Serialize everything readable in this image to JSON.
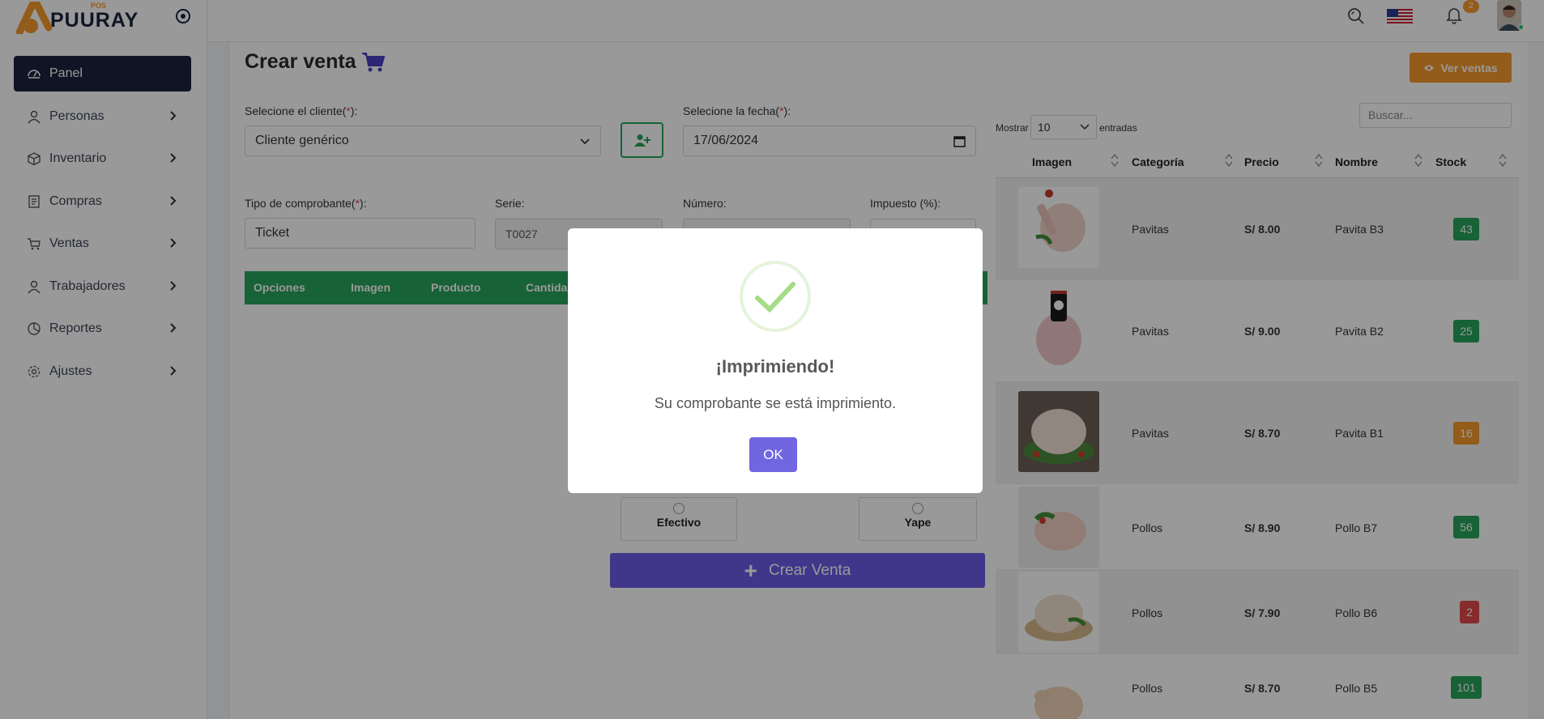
{
  "brand": {
    "name": "PUURAY",
    "tag": "POS",
    "accent": "#f59a2c",
    "dark": "#1c2340"
  },
  "sidebar": {
    "items": [
      {
        "label": "Panel",
        "icon": "gauge-icon",
        "active": true
      },
      {
        "label": "Personas",
        "icon": "user-icon"
      },
      {
        "label": "Inventario",
        "icon": "box-icon"
      },
      {
        "label": "Compras",
        "icon": "receipt-icon"
      },
      {
        "label": "Ventas",
        "icon": "cart-icon"
      },
      {
        "label": "Trabajadores",
        "icon": "user-icon"
      },
      {
        "label": "Reportes",
        "icon": "pie-chart-icon"
      },
      {
        "label": "Ajustes",
        "icon": "gear-icon"
      }
    ]
  },
  "topbar": {
    "notifications": "2",
    "language_icon": "us-flag-icon"
  },
  "page": {
    "title": "Crear venta",
    "view_sales": "Ver ventas"
  },
  "form": {
    "client_label": "Selecione el cliente(",
    "client_req": "*",
    "client_label_end": "):",
    "client_value": "Cliente genérico",
    "date_label": "Selecione la fecha(",
    "date_req": "*",
    "date_label_end": "):",
    "date_value": "17/06/2024",
    "voucher_label": "Tipo de comprobante(",
    "voucher_req": "*",
    "voucher_label_end": "):",
    "voucher_value": "Ticket",
    "series_label": "Serie:",
    "series_value": "T0027",
    "number_label": "Número:",
    "tax_label": "Impuesto (%):"
  },
  "detail_table": {
    "columns": [
      "Opciones",
      "Imagen",
      "Producto",
      "Cantida"
    ]
  },
  "payment": {
    "cash": "Efectivo",
    "yape": "Yape"
  },
  "create_button": "Crear Venta",
  "products": {
    "show_label": "Mostrar",
    "entries_label": "entradas",
    "page_length": "10",
    "search_placeholder": "Buscar...",
    "columns": [
      "Imagen",
      "Categoría",
      "Precio",
      "Nombre",
      "Stock"
    ],
    "rows": [
      {
        "category": "Pavitas",
        "price": "S/ 8.00",
        "name": "Pavita B3",
        "stock": "43",
        "stock_color": "#27a35a"
      },
      {
        "category": "Pavitas",
        "price": "S/ 9.00",
        "name": "Pavita B2",
        "stock": "25",
        "stock_color": "#27a35a"
      },
      {
        "category": "Pavitas",
        "price": "S/ 8.70",
        "name": "Pavita B1",
        "stock": "16",
        "stock_color": "#f59a2c"
      },
      {
        "category": "Pollos",
        "price": "S/ 8.90",
        "name": "Pollo B7",
        "stock": "56",
        "stock_color": "#27a35a"
      },
      {
        "category": "Pollos",
        "price": "S/ 7.90",
        "name": "Pollo B6",
        "stock": "2",
        "stock_color": "#e24a4a"
      },
      {
        "category": "Pollos",
        "price": "S/ 8.70",
        "name": "Pollo B5",
        "stock": "101",
        "stock_color": "#27a35a"
      }
    ]
  },
  "modal": {
    "title": "¡Imprimiendo!",
    "text": "Su comprobante se está imprimiento.",
    "ok": "OK",
    "icon": "success-check-icon"
  }
}
